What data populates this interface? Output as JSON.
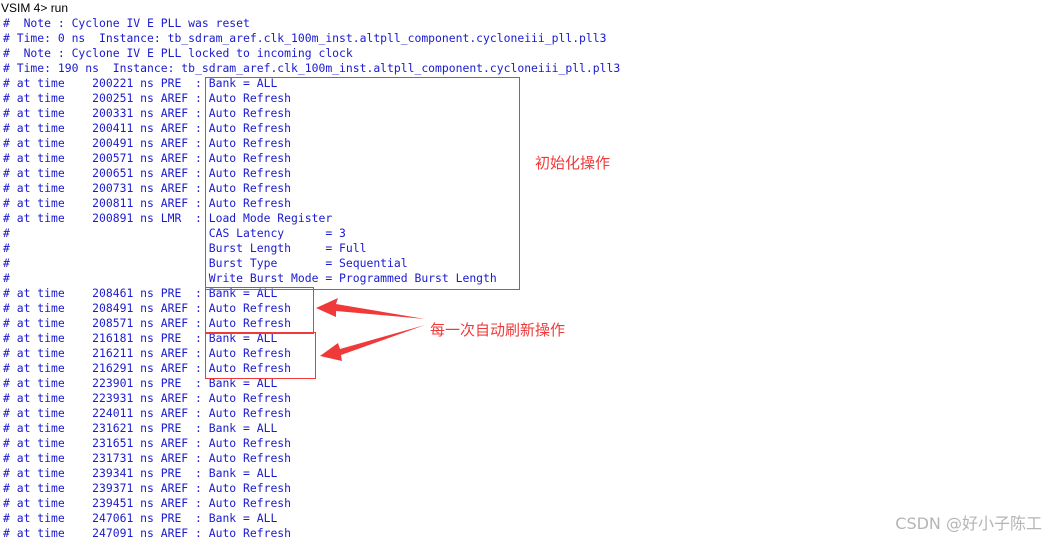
{
  "console": {
    "prompt": "VSIM 4> run",
    "lines": [
      "#  Note : Cyclone IV E PLL was reset",
      "# Time: 0 ns  Instance: tb_sdram_aref.clk_100m_inst.altpll_component.cycloneiii_pll.pll3",
      "#  Note : Cyclone IV E PLL locked to incoming clock",
      "# Time: 190 ns  Instance: tb_sdram_aref.clk_100m_inst.altpll_component.cycloneiii_pll.pll3",
      "# at time    200221 ns PRE  : Bank = ALL",
      "# at time    200251 ns AREF : Auto Refresh",
      "# at time    200331 ns AREF : Auto Refresh",
      "# at time    200411 ns AREF : Auto Refresh",
      "# at time    200491 ns AREF : Auto Refresh",
      "# at time    200571 ns AREF : Auto Refresh",
      "# at time    200651 ns AREF : Auto Refresh",
      "# at time    200731 ns AREF : Auto Refresh",
      "# at time    200811 ns AREF : Auto Refresh",
      "# at time    200891 ns LMR  : Load Mode Register",
      "#                             CAS Latency      = 3",
      "#                             Burst Length     = Full",
      "#                             Burst Type       = Sequential",
      "#                             Write Burst Mode = Programmed Burst Length",
      "# at time    208461 ns PRE  : Bank = ALL",
      "# at time    208491 ns AREF : Auto Refresh",
      "# at time    208571 ns AREF : Auto Refresh",
      "# at time    216181 ns PRE  : Bank = ALL",
      "# at time    216211 ns AREF : Auto Refresh",
      "# at time    216291 ns AREF : Auto Refresh",
      "# at time    223901 ns PRE  : Bank = ALL",
      "# at time    223931 ns AREF : Auto Refresh",
      "# at time    224011 ns AREF : Auto Refresh",
      "# at time    231621 ns PRE  : Bank = ALL",
      "# at time    231651 ns AREF : Auto Refresh",
      "# at time    231731 ns AREF : Auto Refresh",
      "# at time    239341 ns PRE  : Bank = ALL",
      "# at time    239371 ns AREF : Auto Refresh",
      "# at time    239451 ns AREF : Auto Refresh",
      "# at time    247061 ns PRE  : Bank = ALL",
      "# at time    247091 ns AREF : Auto Refresh"
    ]
  },
  "annotations": {
    "init": "初始化操作",
    "refresh": "每一次自动刷新操作"
  },
  "watermark": "CSDN @好小子陈工",
  "colors": {
    "text": "#1a1ad0",
    "annotation": "#f03a3a",
    "watermark": "#b5b5b5"
  }
}
